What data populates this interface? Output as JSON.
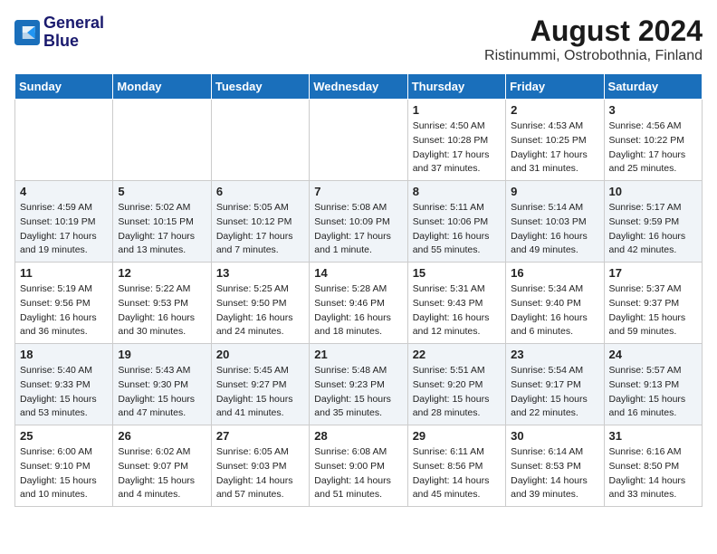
{
  "logo": {
    "line1": "General",
    "line2": "Blue"
  },
  "title": "August 2024",
  "location": "Ristinummi, Ostrobothnia, Finland",
  "headers": [
    "Sunday",
    "Monday",
    "Tuesday",
    "Wednesday",
    "Thursday",
    "Friday",
    "Saturday"
  ],
  "weeks": [
    [
      {
        "day": "",
        "info": ""
      },
      {
        "day": "",
        "info": ""
      },
      {
        "day": "",
        "info": ""
      },
      {
        "day": "",
        "info": ""
      },
      {
        "day": "1",
        "info": "Sunrise: 4:50 AM\nSunset: 10:28 PM\nDaylight: 17 hours and 37 minutes."
      },
      {
        "day": "2",
        "info": "Sunrise: 4:53 AM\nSunset: 10:25 PM\nDaylight: 17 hours and 31 minutes."
      },
      {
        "day": "3",
        "info": "Sunrise: 4:56 AM\nSunset: 10:22 PM\nDaylight: 17 hours and 25 minutes."
      }
    ],
    [
      {
        "day": "4",
        "info": "Sunrise: 4:59 AM\nSunset: 10:19 PM\nDaylight: 17 hours and 19 minutes."
      },
      {
        "day": "5",
        "info": "Sunrise: 5:02 AM\nSunset: 10:15 PM\nDaylight: 17 hours and 13 minutes."
      },
      {
        "day": "6",
        "info": "Sunrise: 5:05 AM\nSunset: 10:12 PM\nDaylight: 17 hours and 7 minutes."
      },
      {
        "day": "7",
        "info": "Sunrise: 5:08 AM\nSunset: 10:09 PM\nDaylight: 17 hours and 1 minute."
      },
      {
        "day": "8",
        "info": "Sunrise: 5:11 AM\nSunset: 10:06 PM\nDaylight: 16 hours and 55 minutes."
      },
      {
        "day": "9",
        "info": "Sunrise: 5:14 AM\nSunset: 10:03 PM\nDaylight: 16 hours and 49 minutes."
      },
      {
        "day": "10",
        "info": "Sunrise: 5:17 AM\nSunset: 9:59 PM\nDaylight: 16 hours and 42 minutes."
      }
    ],
    [
      {
        "day": "11",
        "info": "Sunrise: 5:19 AM\nSunset: 9:56 PM\nDaylight: 16 hours and 36 minutes."
      },
      {
        "day": "12",
        "info": "Sunrise: 5:22 AM\nSunset: 9:53 PM\nDaylight: 16 hours and 30 minutes."
      },
      {
        "day": "13",
        "info": "Sunrise: 5:25 AM\nSunset: 9:50 PM\nDaylight: 16 hours and 24 minutes."
      },
      {
        "day": "14",
        "info": "Sunrise: 5:28 AM\nSunset: 9:46 PM\nDaylight: 16 hours and 18 minutes."
      },
      {
        "day": "15",
        "info": "Sunrise: 5:31 AM\nSunset: 9:43 PM\nDaylight: 16 hours and 12 minutes."
      },
      {
        "day": "16",
        "info": "Sunrise: 5:34 AM\nSunset: 9:40 PM\nDaylight: 16 hours and 6 minutes."
      },
      {
        "day": "17",
        "info": "Sunrise: 5:37 AM\nSunset: 9:37 PM\nDaylight: 15 hours and 59 minutes."
      }
    ],
    [
      {
        "day": "18",
        "info": "Sunrise: 5:40 AM\nSunset: 9:33 PM\nDaylight: 15 hours and 53 minutes."
      },
      {
        "day": "19",
        "info": "Sunrise: 5:43 AM\nSunset: 9:30 PM\nDaylight: 15 hours and 47 minutes."
      },
      {
        "day": "20",
        "info": "Sunrise: 5:45 AM\nSunset: 9:27 PM\nDaylight: 15 hours and 41 minutes."
      },
      {
        "day": "21",
        "info": "Sunrise: 5:48 AM\nSunset: 9:23 PM\nDaylight: 15 hours and 35 minutes."
      },
      {
        "day": "22",
        "info": "Sunrise: 5:51 AM\nSunset: 9:20 PM\nDaylight: 15 hours and 28 minutes."
      },
      {
        "day": "23",
        "info": "Sunrise: 5:54 AM\nSunset: 9:17 PM\nDaylight: 15 hours and 22 minutes."
      },
      {
        "day": "24",
        "info": "Sunrise: 5:57 AM\nSunset: 9:13 PM\nDaylight: 15 hours and 16 minutes."
      }
    ],
    [
      {
        "day": "25",
        "info": "Sunrise: 6:00 AM\nSunset: 9:10 PM\nDaylight: 15 hours and 10 minutes."
      },
      {
        "day": "26",
        "info": "Sunrise: 6:02 AM\nSunset: 9:07 PM\nDaylight: 15 hours and 4 minutes."
      },
      {
        "day": "27",
        "info": "Sunrise: 6:05 AM\nSunset: 9:03 PM\nDaylight: 14 hours and 57 minutes."
      },
      {
        "day": "28",
        "info": "Sunrise: 6:08 AM\nSunset: 9:00 PM\nDaylight: 14 hours and 51 minutes."
      },
      {
        "day": "29",
        "info": "Sunrise: 6:11 AM\nSunset: 8:56 PM\nDaylight: 14 hours and 45 minutes."
      },
      {
        "day": "30",
        "info": "Sunrise: 6:14 AM\nSunset: 8:53 PM\nDaylight: 14 hours and 39 minutes."
      },
      {
        "day": "31",
        "info": "Sunrise: 6:16 AM\nSunset: 8:50 PM\nDaylight: 14 hours and 33 minutes."
      }
    ]
  ]
}
